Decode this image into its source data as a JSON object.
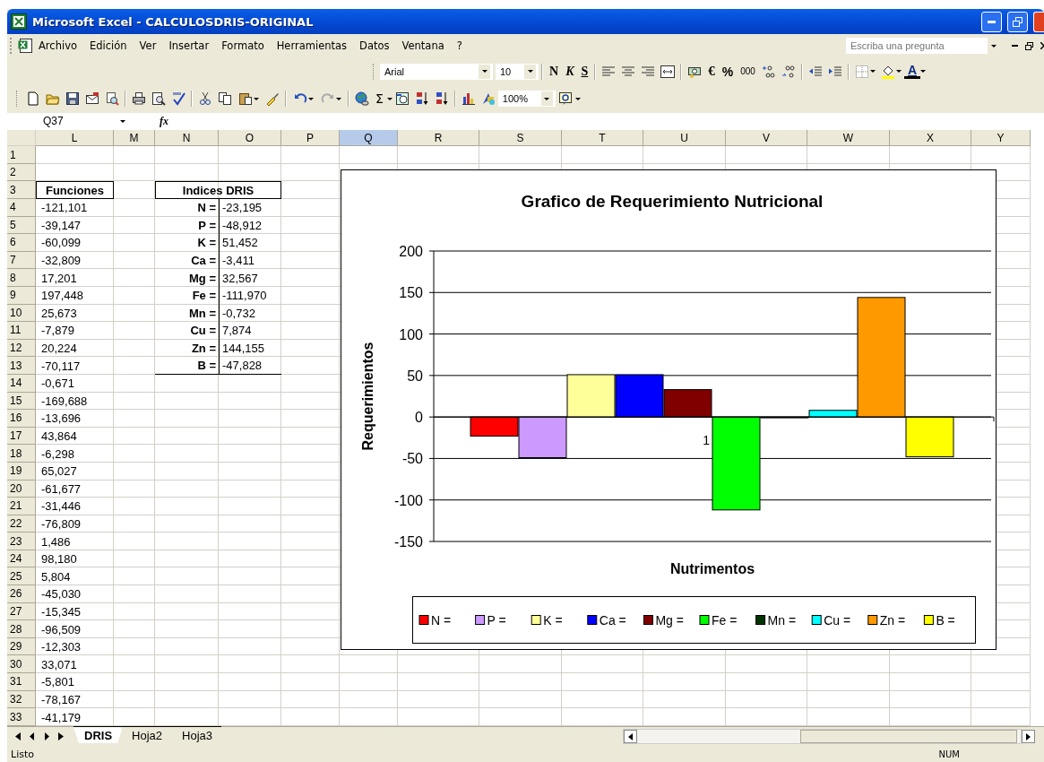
{
  "window": {
    "title": "Microsoft Excel - CALCULOSDRIS-ORIGINAL"
  },
  "menu": {
    "items": [
      "Archivo",
      "Edición",
      "Ver",
      "Insertar",
      "Formato",
      "Herramientas",
      "Datos",
      "Ventana",
      "?"
    ],
    "help_search": {
      "placeholder": "Escriba una pregunta"
    }
  },
  "formatting_toolbar": {
    "font": "Arial",
    "size": "10",
    "bold": "N",
    "italic": "K",
    "underline": "S",
    "euro": "€",
    "percent": "%",
    "thousands": "000",
    "font_color": "A"
  },
  "standard_toolbar": {
    "autosum": "Σ",
    "zoom": "100%"
  },
  "formula_bar": {
    "name_box": "Q37",
    "fx": "fx"
  },
  "sheet": {
    "columns": [
      {
        "label": "L",
        "selected": false
      },
      {
        "label": "M",
        "selected": false
      },
      {
        "label": "N",
        "selected": false
      },
      {
        "label": "O",
        "selected": false
      },
      {
        "label": "P",
        "selected": false
      },
      {
        "label": "Q",
        "selected": true
      },
      {
        "label": "R",
        "selected": false
      },
      {
        "label": "S",
        "selected": false
      },
      {
        "label": "T",
        "selected": false
      },
      {
        "label": "U",
        "selected": false
      },
      {
        "label": "V",
        "selected": false
      },
      {
        "label": "W",
        "selected": false
      },
      {
        "label": "X",
        "selected": false
      },
      {
        "label": "Y",
        "selected": false
      }
    ],
    "rows": [
      {
        "number": "1"
      },
      {
        "number": "2"
      },
      {
        "number": "3",
        "kind": "header",
        "L": "Funciones",
        "N_O": "Indices DRIS"
      },
      {
        "number": "4",
        "L": "-121,101",
        "N": "N =",
        "O": "-23,195"
      },
      {
        "number": "5",
        "L": "-39,147",
        "N": "P =",
        "O": "-48,912"
      },
      {
        "number": "6",
        "L": "-60,099",
        "N": "K =",
        "O": "51,452"
      },
      {
        "number": "7",
        "L": "-32,809",
        "N": "Ca =",
        "O": "-3,411"
      },
      {
        "number": "8",
        "L": "17,201",
        "N": "Mg =",
        "O": "32,567"
      },
      {
        "number": "9",
        "L": "197,448",
        "N": "Fe =",
        "O": "-111,970"
      },
      {
        "number": "10",
        "L": "25,673",
        "N": "Mn =",
        "O": "-0,732"
      },
      {
        "number": "11",
        "L": "-7,879",
        "N": "Cu =",
        "O": "7,874"
      },
      {
        "number": "12",
        "L": "20,224",
        "N": "Zn =",
        "O": "144,155"
      },
      {
        "number": "13",
        "L": "-70,117",
        "N": "B =",
        "O": "-47,828"
      },
      {
        "number": "14",
        "L": "-0,671"
      },
      {
        "number": "15",
        "L": "-169,688"
      },
      {
        "number": "16",
        "L": "-13,696"
      },
      {
        "number": "17",
        "L": "43,864"
      },
      {
        "number": "18",
        "L": "-6,298"
      },
      {
        "number": "19",
        "L": "65,027"
      },
      {
        "number": "20",
        "L": "-61,677"
      },
      {
        "number": "21",
        "L": "-31,446"
      },
      {
        "number": "22",
        "L": "-76,809"
      },
      {
        "number": "23",
        "L": "1,486"
      },
      {
        "number": "24",
        "L": "98,180"
      },
      {
        "number": "25",
        "L": "5,804"
      },
      {
        "number": "26",
        "L": "-45,030"
      },
      {
        "number": "27",
        "L": "-15,345"
      },
      {
        "number": "28",
        "L": "-96,509"
      },
      {
        "number": "29",
        "L": "-12,303"
      },
      {
        "number": "30",
        "L": "33,071"
      },
      {
        "number": "31",
        "L": "-5,801"
      },
      {
        "number": "32",
        "L": "-78,167"
      },
      {
        "number": "33",
        "L": "-41,179"
      }
    ]
  },
  "chart": {
    "chart_data": {
      "type": "bar",
      "grid": true,
      "legend": true,
      "title": "Grafico de Requerimiento Nutricional",
      "xlabel": "Nutrimentos",
      "ylabel": "Requerimientos",
      "categories": [
        "1"
      ],
      "ylim": [
        -150,
        200
      ],
      "yticks": [
        -150,
        -100,
        -50,
        0,
        50,
        100,
        150,
        200
      ],
      "series": [
        {
          "name": "N =",
          "color": "#ff0000",
          "values": [
            -23
          ]
        },
        {
          "name": "P =",
          "color": "#cc99ff",
          "values": [
            -49
          ]
        },
        {
          "name": "K =",
          "color": "#ffff99",
          "values": [
            51
          ]
        },
        {
          "name": "Ca =",
          "color": "#0000ff",
          "values": [
            51
          ]
        },
        {
          "name": "Mg =",
          "color": "#800000",
          "values": [
            33
          ]
        },
        {
          "name": "Fe =",
          "color": "#00ff00",
          "values": [
            -112
          ]
        },
        {
          "name": "Mn =",
          "color": "#003300",
          "values": [
            -1
          ]
        },
        {
          "name": "Cu =",
          "color": "#00ffff",
          "values": [
            8
          ]
        },
        {
          "name": "Zn =",
          "color": "#ff9900",
          "values": [
            144
          ]
        },
        {
          "name": "B =",
          "color": "#ffff00",
          "values": [
            -48
          ]
        }
      ]
    }
  },
  "sheet_tabs": [
    {
      "label": "DRIS",
      "selected": true
    },
    {
      "label": "Hoja2",
      "selected": false
    },
    {
      "label": "Hoja3",
      "selected": false
    }
  ],
  "status_bar": {
    "left": "Listo",
    "indicator": "NUM"
  }
}
